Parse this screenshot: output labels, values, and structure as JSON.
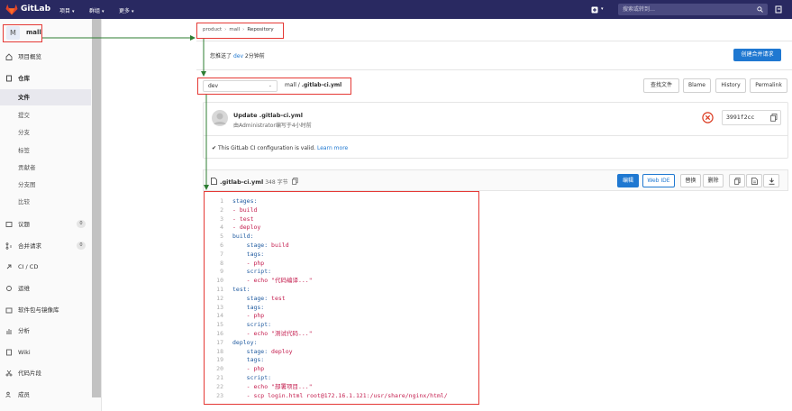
{
  "nav": {
    "brand": "GitLab",
    "menus": [
      "项目",
      "群组",
      "更多"
    ],
    "search_placeholder": "搜索或转到…"
  },
  "sidebar": {
    "project_initial": "M",
    "project_name": "mall",
    "items": [
      {
        "label": "项目概览"
      },
      {
        "label": "仓库"
      },
      {
        "label": "文件"
      },
      {
        "label": "提交"
      },
      {
        "label": "分支"
      },
      {
        "label": "标签"
      },
      {
        "label": "贡献者"
      },
      {
        "label": "分支图"
      },
      {
        "label": "比较"
      },
      {
        "label": "议题",
        "badge": "0"
      },
      {
        "label": "合并请求",
        "badge": "0"
      },
      {
        "label": "CI / CD"
      },
      {
        "label": "运维"
      },
      {
        "label": "软件包与镜像库"
      },
      {
        "label": "分析"
      },
      {
        "label": "Wiki"
      },
      {
        "label": "代码片段"
      },
      {
        "label": "成员"
      }
    ]
  },
  "breadcrumb": [
    "product",
    "mall",
    "Repository"
  ],
  "push_message": {
    "prefix": "您推送了",
    "branch": "dev",
    "suffix": "2分钟前"
  },
  "create_mr_label": "创建合并请求",
  "branch_selector": "dev",
  "file_path": {
    "project": "mall",
    "file": ".gitlab-ci.yml"
  },
  "toolbar": {
    "find_file": "查找文件",
    "blame": "Blame",
    "history": "History",
    "permalink": "Permalink"
  },
  "commit": {
    "title": "Update .gitlab-ci.yml",
    "author_line": "由Administrator编写于4小时前",
    "sha": "3991f2cc",
    "ci_valid_text": "This GitLab CI configuration is valid.",
    "learn_more": "Learn more"
  },
  "file": {
    "name": ".gitlab-ci.yml",
    "size": "348 字节",
    "edit": "编辑",
    "web_ide": "Web IDE",
    "replace": "替换",
    "delete": "删除"
  },
  "code_lines": [
    "stages:",
    "- build",
    "- test",
    "- deploy",
    "build:",
    "    stage: build",
    "    tags:",
    "    - php",
    "    script:",
    "    - echo \"代码编译...\"",
    "test:",
    "    stage: test",
    "    tags:",
    "    - php",
    "    script:",
    "    - echo \"测试代码...\"",
    "deploy:",
    "    stage: deploy",
    "    tags:",
    "    - php",
    "    script:",
    "    - echo \"部署项目...\"",
    "    - scp login.html root@172.16.1.121:/usr/share/nginx/html/"
  ],
  "colors": {
    "nav_bg": "#292961",
    "primary": "#1f78d1",
    "annotation": "#e53935",
    "arrow": "#2e7d32"
  }
}
